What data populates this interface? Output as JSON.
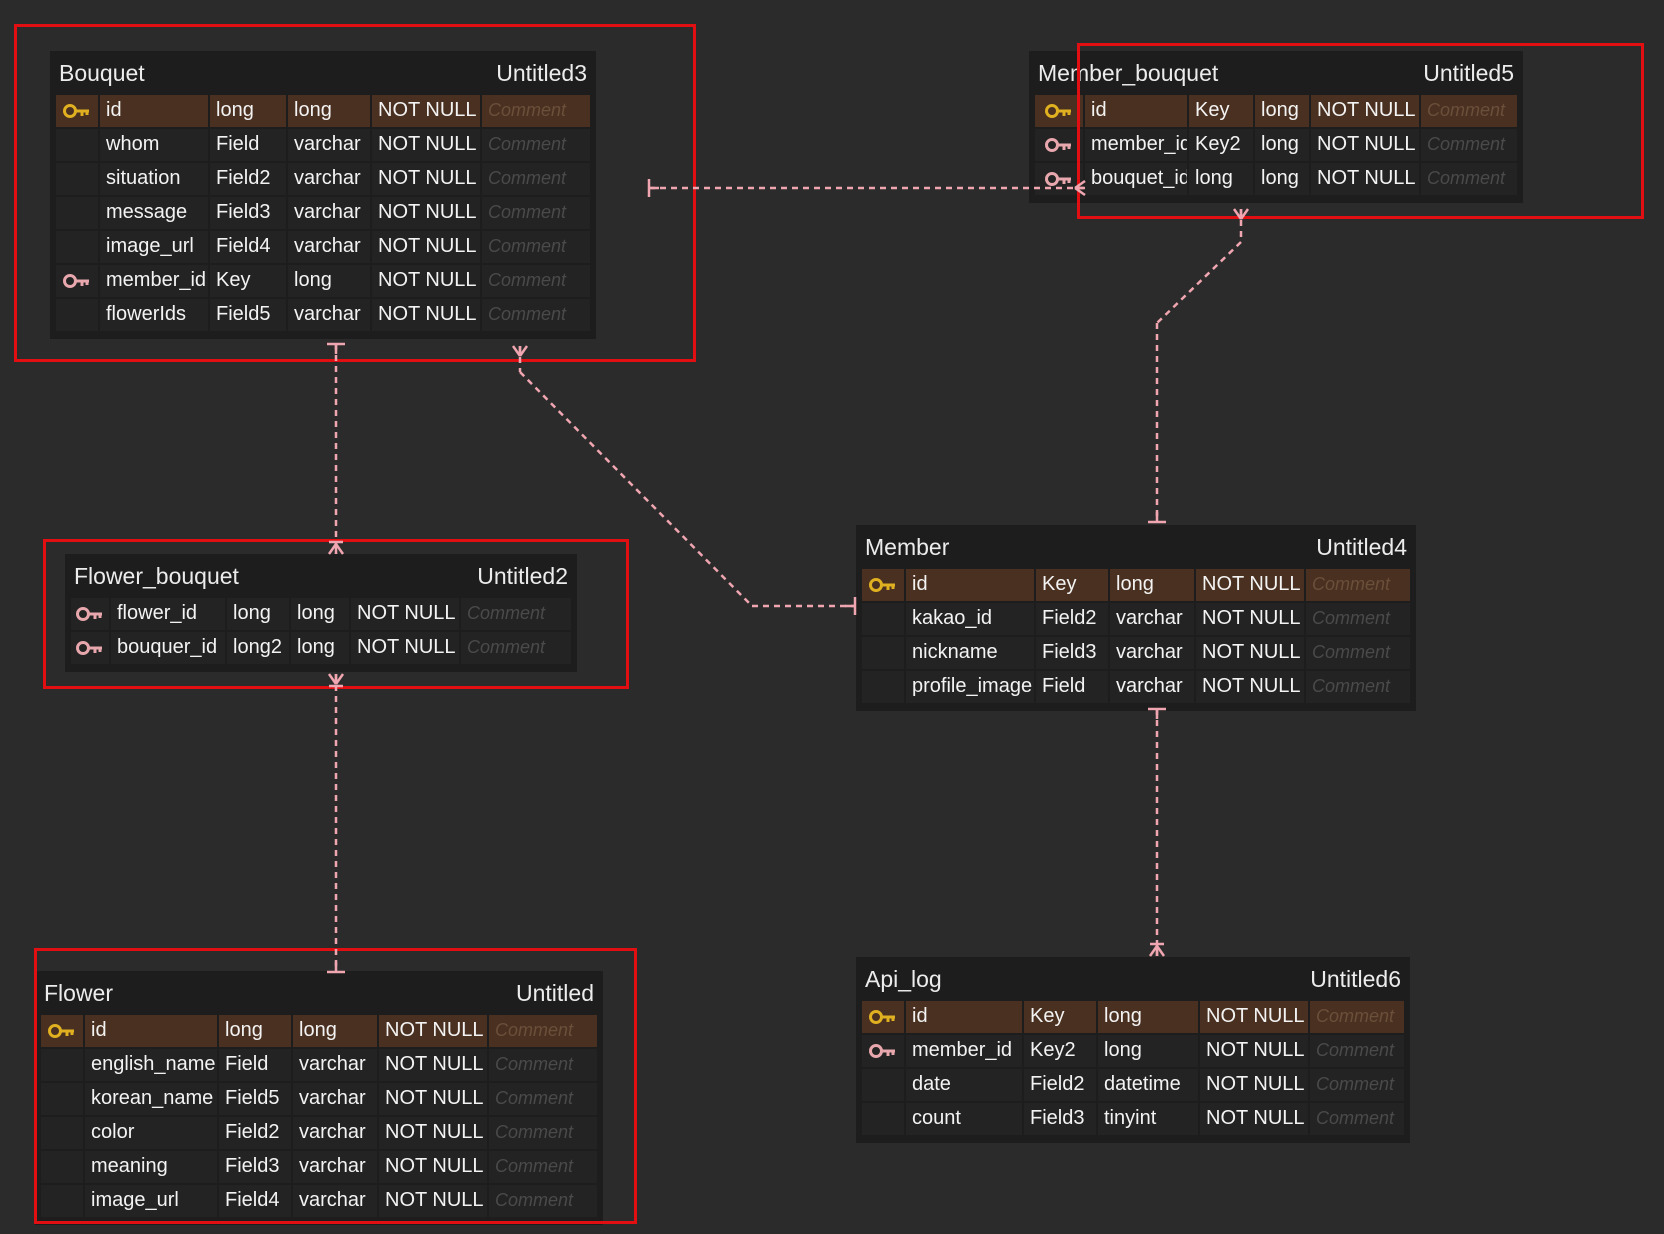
{
  "diagram": {
    "colors": {
      "background": "#2b2b2b",
      "table_body": "#1d1d1d",
      "pk_row": "#4a3020",
      "primary_key_icon": "#e0b020",
      "foreign_key_icon": "#e7a7ad",
      "relation_line": "#f0a6b0",
      "highlight_border": "#e10f12"
    },
    "tables": [
      {
        "id": "bouquet",
        "name": "Bouquet",
        "alias": "Untitled3",
        "highlighted": true,
        "rows": [
          {
            "key": "primary",
            "cells": [
              "id",
              "long",
              "long",
              "NOT NULL",
              "Comment"
            ]
          },
          {
            "key": "",
            "cells": [
              "whom",
              "Field",
              "varchar",
              "NOT NULL",
              "Comment"
            ]
          },
          {
            "key": "",
            "cells": [
              "situation",
              "Field2",
              "varchar",
              "NOT NULL",
              "Comment"
            ]
          },
          {
            "key": "",
            "cells": [
              "message",
              "Field3",
              "varchar",
              "NOT NULL",
              "Comment"
            ]
          },
          {
            "key": "",
            "cells": [
              "image_url",
              "Field4",
              "varchar",
              "NOT NULL",
              "Comment"
            ]
          },
          {
            "key": "foreign",
            "cells": [
              "member_id",
              "Key",
              "long",
              "NOT NULL",
              "Comment"
            ]
          },
          {
            "key": "",
            "cells": [
              "flowerIds",
              "Field5",
              "varchar",
              "NOT NULL",
              "Comment"
            ]
          }
        ]
      },
      {
        "id": "member_bouquet",
        "name": "Member_bouquet",
        "alias": "Untitled5",
        "highlighted": true,
        "rows": [
          {
            "key": "primary",
            "cells": [
              "id",
              "Key",
              "long",
              "NOT NULL",
              "Comment"
            ]
          },
          {
            "key": "foreign",
            "cells": [
              "member_id",
              "Key2",
              "long",
              "NOT NULL",
              "Comment"
            ]
          },
          {
            "key": "foreign",
            "cells": [
              "bouquet_id",
              "long",
              "long",
              "NOT NULL",
              "Comment"
            ]
          }
        ]
      },
      {
        "id": "flower_bouquet",
        "name": "Flower_bouquet",
        "alias": "Untitled2",
        "highlighted": true,
        "rows": [
          {
            "key": "foreign",
            "cells": [
              "flower_id",
              "long",
              "long",
              "NOT NULL",
              "Comment"
            ]
          },
          {
            "key": "foreign",
            "cells": [
              "bouquer_id",
              "long2",
              "long",
              "NOT NULL",
              "Comment"
            ]
          }
        ]
      },
      {
        "id": "member",
        "name": "Member",
        "alias": "Untitled4",
        "highlighted": false,
        "rows": [
          {
            "key": "primary",
            "cells": [
              "id",
              "Key",
              "long",
              "NOT NULL",
              "Comment"
            ]
          },
          {
            "key": "",
            "cells": [
              "kakao_id",
              "Field2",
              "varchar",
              "NOT NULL",
              "Comment"
            ]
          },
          {
            "key": "",
            "cells": [
              "nickname",
              "Field3",
              "varchar",
              "NOT NULL",
              "Comment"
            ]
          },
          {
            "key": "",
            "cells": [
              "profile_image",
              "Field",
              "varchar",
              "NOT NULL",
              "Comment"
            ]
          }
        ]
      },
      {
        "id": "flower",
        "name": "Flower",
        "alias": "Untitled",
        "highlighted": true,
        "rows": [
          {
            "key": "primary",
            "cells": [
              "id",
              "long",
              "long",
              "NOT NULL",
              "Comment"
            ]
          },
          {
            "key": "",
            "cells": [
              "english_name",
              "Field",
              "varchar",
              "NOT NULL",
              "Comment"
            ]
          },
          {
            "key": "",
            "cells": [
              "korean_name",
              "Field5",
              "varchar",
              "NOT NULL",
              "Comment"
            ]
          },
          {
            "key": "",
            "cells": [
              "color",
              "Field2",
              "varchar",
              "NOT NULL",
              "Comment"
            ]
          },
          {
            "key": "",
            "cells": [
              "meaning",
              "Field3",
              "varchar",
              "NOT NULL",
              "Comment"
            ]
          },
          {
            "key": "",
            "cells": [
              "image_url",
              "Field4",
              "varchar",
              "NOT NULL",
              "Comment"
            ]
          }
        ]
      },
      {
        "id": "api_log",
        "name": "Api_log",
        "alias": "Untitled6",
        "highlighted": false,
        "rows": [
          {
            "key": "primary",
            "cells": [
              "id",
              "Key",
              "long",
              "NOT NULL",
              "Comment"
            ]
          },
          {
            "key": "foreign",
            "cells": [
              "member_id",
              "Key2",
              "long",
              "NOT NULL",
              "Comment"
            ]
          },
          {
            "key": "",
            "cells": [
              "date",
              "Field2",
              "datetime",
              "NOT NULL",
              "Comment"
            ]
          },
          {
            "key": "",
            "cells": [
              "count",
              "Field3",
              "tinyint",
              "NOT NULL",
              "Comment"
            ]
          }
        ]
      }
    ],
    "relations": [
      {
        "from": "bouquet",
        "from_end": "one",
        "to": "member_bouquet",
        "to_end": "many-optional"
      },
      {
        "from": "bouquet",
        "from_end": "one",
        "to": "flower_bouquet",
        "to_end": "many"
      },
      {
        "from": "bouquet",
        "from_end": "many-optional",
        "to": "member",
        "to_end": "one"
      },
      {
        "from": "member_bouquet",
        "from_end": "many-optional",
        "to": "member",
        "to_end": "one"
      },
      {
        "from": "flower_bouquet",
        "from_end": "many",
        "to": "flower",
        "to_end": "one"
      },
      {
        "from": "member",
        "from_end": "one",
        "to": "api_log",
        "to_end": "many"
      }
    ]
  }
}
